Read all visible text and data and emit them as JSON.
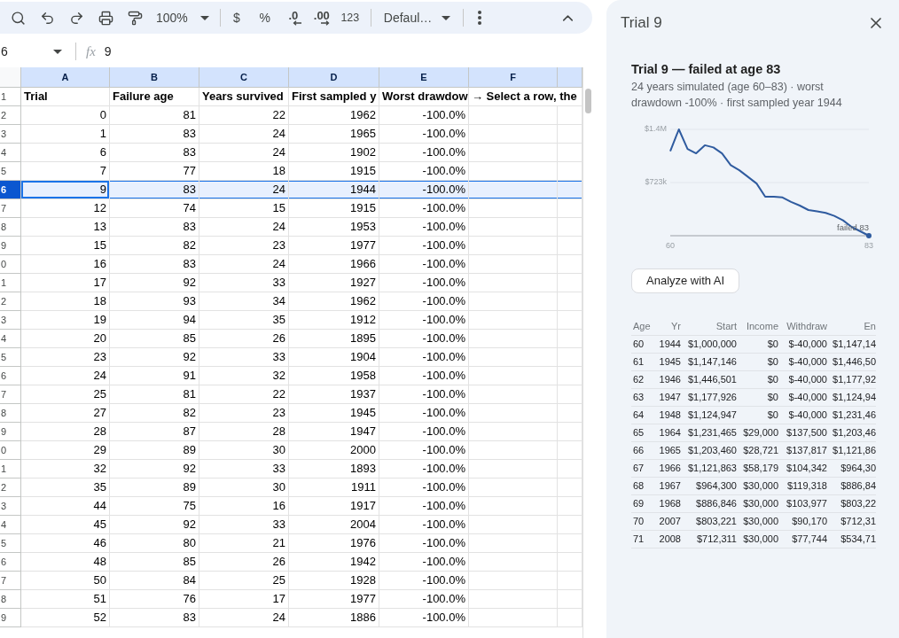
{
  "toolbar": {
    "zoom": "100%",
    "currency": "$",
    "percent": "%",
    "decrease_decimal": ".0",
    "increase_decimal": ".00",
    "number_format": "123",
    "font": "Defaul…"
  },
  "formula_bar": {
    "cell_ref": "6",
    "fx": "fx",
    "value": "9"
  },
  "sheet": {
    "columns": [
      {
        "label": "A",
        "highlighted": true,
        "active": true
      },
      {
        "label": "B",
        "highlighted": true,
        "active": false
      },
      {
        "label": "C",
        "highlighted": true,
        "active": false
      },
      {
        "label": "D",
        "highlighted": true,
        "active": false
      },
      {
        "label": "E",
        "highlighted": true,
        "active": false
      },
      {
        "label": "F",
        "highlighted": true,
        "active": false
      },
      {
        "highlighted": true,
        "active": false
      }
    ],
    "header_row": {
      "number": "1",
      "selected": false,
      "cells": [
        "Trial",
        "Failure age",
        "Years survived",
        "First sampled y",
        "Worst drawdow",
        "→ Select a row, the"
      ]
    },
    "rows": [
      {
        "number": "2",
        "selected": false,
        "cells": [
          "0",
          "81",
          "22",
          "1962",
          "-100.0%"
        ]
      },
      {
        "number": "3",
        "selected": false,
        "cells": [
          "1",
          "83",
          "24",
          "1965",
          "-100.0%"
        ]
      },
      {
        "number": "4",
        "selected": false,
        "cells": [
          "6",
          "83",
          "24",
          "1902",
          "-100.0%"
        ]
      },
      {
        "number": "5",
        "selected": false,
        "cells": [
          "7",
          "77",
          "18",
          "1915",
          "-100.0%"
        ]
      },
      {
        "number": "6",
        "selected": true,
        "cells": [
          "9",
          "83",
          "24",
          "1944",
          "-100.0%"
        ]
      },
      {
        "number": "7",
        "selected": false,
        "cells": [
          "12",
          "74",
          "15",
          "1915",
          "-100.0%"
        ]
      },
      {
        "number": "8",
        "selected": false,
        "cells": [
          "13",
          "83",
          "24",
          "1953",
          "-100.0%"
        ]
      },
      {
        "number": "9",
        "selected": false,
        "cells": [
          "15",
          "82",
          "23",
          "1977",
          "-100.0%"
        ]
      },
      {
        "number": "0",
        "selected": false,
        "cells": [
          "16",
          "83",
          "24",
          "1966",
          "-100.0%"
        ]
      },
      {
        "number": "1",
        "selected": false,
        "cells": [
          "17",
          "92",
          "33",
          "1927",
          "-100.0%"
        ]
      },
      {
        "number": "2",
        "selected": false,
        "cells": [
          "18",
          "93",
          "34",
          "1962",
          "-100.0%"
        ]
      },
      {
        "number": "3",
        "selected": false,
        "cells": [
          "19",
          "94",
          "35",
          "1912",
          "-100.0%"
        ]
      },
      {
        "number": "4",
        "selected": false,
        "cells": [
          "20",
          "85",
          "26",
          "1895",
          "-100.0%"
        ]
      },
      {
        "number": "5",
        "selected": false,
        "cells": [
          "23",
          "92",
          "33",
          "1904",
          "-100.0%"
        ]
      },
      {
        "number": "6",
        "selected": false,
        "cells": [
          "24",
          "91",
          "32",
          "1958",
          "-100.0%"
        ]
      },
      {
        "number": "7",
        "selected": false,
        "cells": [
          "25",
          "81",
          "22",
          "1937",
          "-100.0%"
        ]
      },
      {
        "number": "8",
        "selected": false,
        "cells": [
          "27",
          "82",
          "23",
          "1945",
          "-100.0%"
        ]
      },
      {
        "number": "9",
        "selected": false,
        "cells": [
          "28",
          "87",
          "28",
          "1947",
          "-100.0%"
        ]
      },
      {
        "number": "0",
        "selected": false,
        "cells": [
          "29",
          "89",
          "30",
          "2000",
          "-100.0%"
        ]
      },
      {
        "number": "1",
        "selected": false,
        "cells": [
          "32",
          "92",
          "33",
          "1893",
          "-100.0%"
        ]
      },
      {
        "number": "2",
        "selected": false,
        "cells": [
          "35",
          "89",
          "30",
          "1911",
          "-100.0%"
        ]
      },
      {
        "number": "3",
        "selected": false,
        "cells": [
          "44",
          "75",
          "16",
          "1917",
          "-100.0%"
        ]
      },
      {
        "number": "4",
        "selected": false,
        "cells": [
          "45",
          "92",
          "33",
          "2004",
          "-100.0%"
        ]
      },
      {
        "number": "5",
        "selected": false,
        "cells": [
          "46",
          "80",
          "21",
          "1976",
          "-100.0%"
        ]
      },
      {
        "number": "6",
        "selected": false,
        "cells": [
          "48",
          "85",
          "26",
          "1942",
          "-100.0%"
        ]
      },
      {
        "number": "7",
        "selected": false,
        "cells": [
          "50",
          "84",
          "25",
          "1928",
          "-100.0%"
        ]
      },
      {
        "number": "8",
        "selected": false,
        "cells": [
          "51",
          "76",
          "17",
          "1977",
          "-100.0%"
        ]
      },
      {
        "number": "9",
        "selected": false,
        "cells": [
          "52",
          "83",
          "24",
          "1886",
          "-100.0%"
        ]
      }
    ]
  },
  "panel": {
    "title": "Trial 9",
    "heading": "Trial 9 — failed at age 83",
    "summary": "24 years simulated (age 60–83) · worst drawdown -100% · first sampled year 1944",
    "chart_data": {
      "type": "line",
      "x": [
        60,
        61,
        62,
        63,
        64,
        65,
        66,
        67,
        68,
        69,
        70,
        71,
        72,
        73,
        74,
        75,
        76,
        77,
        78,
        79,
        80,
        81,
        82,
        83
      ],
      "series": [
        {
          "color": "#2f5b9f",
          "values": [
            1150000,
            1446000,
            1180000,
            1120000,
            1230000,
            1200000,
            1120000,
            960000,
            890000,
            800000,
            710000,
            530000,
            530000,
            520000,
            460000,
            410000,
            350000,
            330000,
            310000,
            270000,
            210000,
            120000,
            60000,
            0
          ]
        }
      ],
      "xlim": [
        60,
        83
      ],
      "ylim": [
        0,
        1446000
      ],
      "xticks": [
        60,
        83
      ],
      "yticks": [
        {
          "value": 723000,
          "label": "$723k"
        },
        {
          "value": 1446000,
          "label": "$1.4M"
        }
      ],
      "annotations": [
        {
          "x": 83,
          "y": 0,
          "text": "failed 83"
        }
      ]
    },
    "analyze_button": "Analyze with AI",
    "table": {
      "columns": [
        "Age",
        "Yr",
        "Start",
        "Income",
        "Withdraw",
        "En"
      ],
      "rows": [
        [
          "60",
          "1944",
          "$1,000,000",
          "$0",
          "$-40,000",
          "$1,147,14"
        ],
        [
          "61",
          "1945",
          "$1,147,146",
          "$0",
          "$-40,000",
          "$1,446,50"
        ],
        [
          "62",
          "1946",
          "$1,446,501",
          "$0",
          "$-40,000",
          "$1,177,92"
        ],
        [
          "63",
          "1947",
          "$1,177,926",
          "$0",
          "$-40,000",
          "$1,124,94"
        ],
        [
          "64",
          "1948",
          "$1,124,947",
          "$0",
          "$-40,000",
          "$1,231,46"
        ],
        [
          "65",
          "1964",
          "$1,231,465",
          "$29,000",
          "$137,500",
          "$1,203,46"
        ],
        [
          "66",
          "1965",
          "$1,203,460",
          "$28,721",
          "$137,817",
          "$1,121,86"
        ],
        [
          "67",
          "1966",
          "$1,121,863",
          "$58,179",
          "$104,342",
          "$964,30"
        ],
        [
          "68",
          "1967",
          "$964,300",
          "$30,000",
          "$119,318",
          "$886,84"
        ],
        [
          "69",
          "1968",
          "$886,846",
          "$30,000",
          "$103,977",
          "$803,22"
        ],
        [
          "70",
          "2007",
          "$803,221",
          "$30,000",
          "$90,170",
          "$712,31"
        ],
        [
          "71",
          "2008",
          "$712,311",
          "$30,000",
          "$77,744",
          "$534,71"
        ]
      ]
    }
  }
}
